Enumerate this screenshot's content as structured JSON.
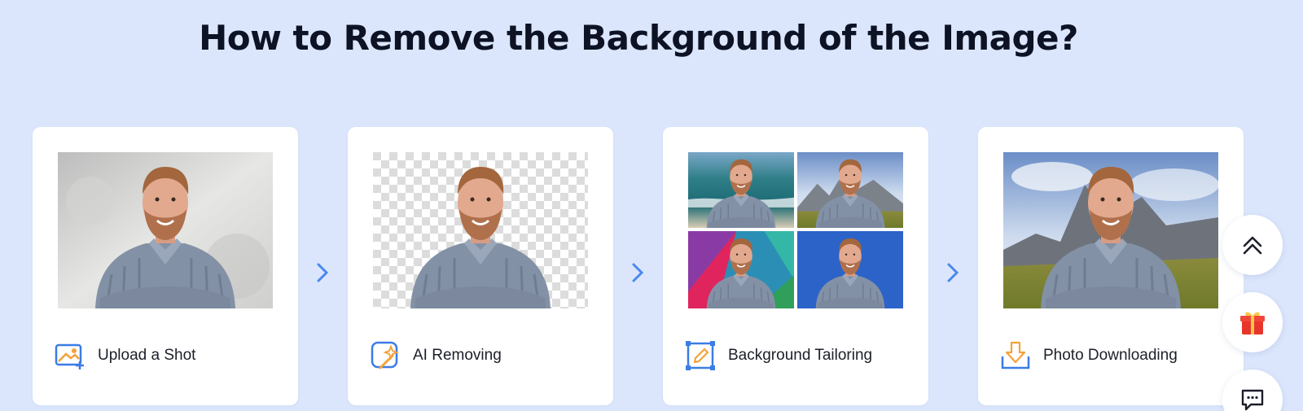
{
  "page": {
    "title": "How to Remove the Background of the Image?"
  },
  "steps": [
    {
      "label": "Upload a Shot",
      "icon": "upload-image-icon",
      "photo_background": "grey-concrete-wall"
    },
    {
      "label": "AI Removing",
      "icon": "ai-magic-wand-icon",
      "photo_background": "transparent-checkerboard"
    },
    {
      "label": "Background Tailoring",
      "icon": "edit-pencil-icon",
      "photo_background": "four-variants-grid"
    },
    {
      "label": "Photo Downloading",
      "icon": "download-arrow-icon",
      "photo_background": "mountain-landscape"
    }
  ],
  "floating_actions": [
    {
      "icon": "double-chevron-up-icon"
    },
    {
      "icon": "gift-icon"
    },
    {
      "icon": "chat-message-icon"
    }
  ],
  "colors": {
    "page_background": "#dbe6fc",
    "accent_blue": "#3b7ce6",
    "arrow_blue": "#4a88ee",
    "icon_orange": "#f2a33a",
    "gift_red": "#e8352c",
    "title_text": "#0d1224"
  }
}
